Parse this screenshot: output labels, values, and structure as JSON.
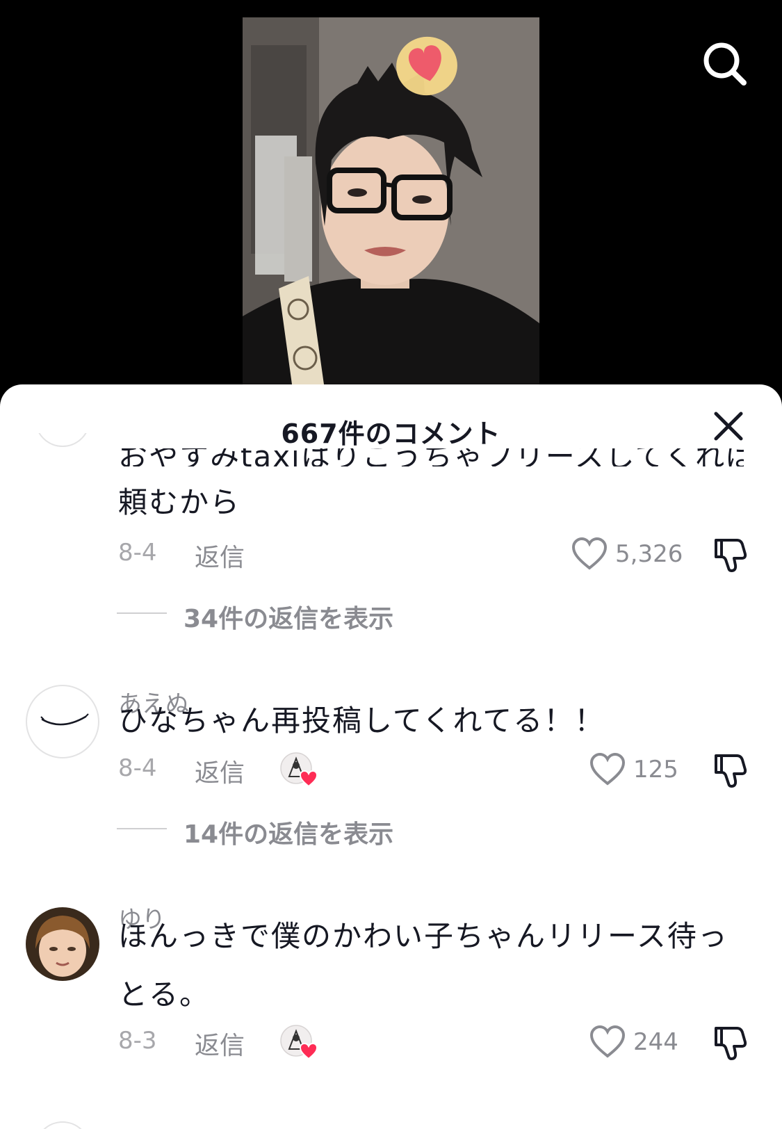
{
  "header": {
    "search_icon": "search-icon"
  },
  "comments_panel": {
    "title": "667件のコメント",
    "close_icon": "close-icon",
    "partial_comment": {
      "text_line_cut": "おやすみtaxiはりこうちゃフリースしてくれば",
      "text_line_2": "頼むから",
      "date": "8-4",
      "reply_label": "返信",
      "likes": "5,326",
      "view_replies": "34件の返信を表示"
    },
    "comments": [
      {
        "username": "あえぬ",
        "text": "ひなちゃん再投稿してくれてる！！",
        "date": "8-4",
        "reply_label": "返信",
        "likes": "125",
        "creator_liked": true,
        "view_replies": "14件の返信を表示"
      },
      {
        "username": "ゆり",
        "text_line_1": "ほんっきで僕のかわい子ちゃんリリース待っ",
        "text_line_2": "とる。",
        "date": "8-3",
        "reply_label": "返信",
        "likes": "244",
        "creator_liked": true
      }
    ]
  },
  "colors": {
    "text_primary": "#161823",
    "text_secondary": "#8a8b91",
    "heart_badge": "#fe2c55",
    "background": "#ffffff"
  }
}
